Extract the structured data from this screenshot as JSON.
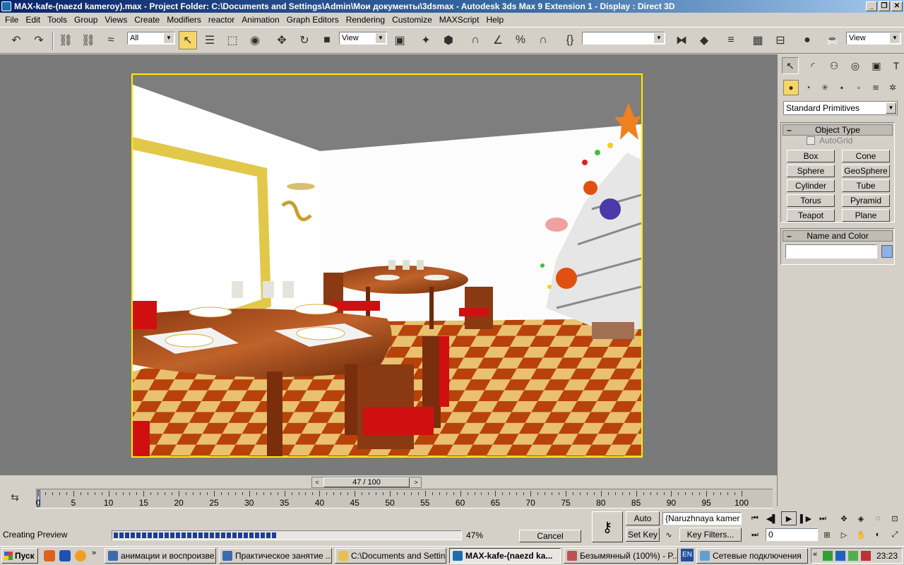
{
  "window": {
    "title": "MAX-kafe-(naezd kameroy).max     - Project Folder: C:\\Documents and Settings\\Admin\\Мои документы\\3dsmax     - Autodesk 3ds Max 9 Extension 1      - Display : Direct 3D"
  },
  "menu": [
    "File",
    "Edit",
    "Tools",
    "Group",
    "Views",
    "Create",
    "Modifiers",
    "reactor",
    "Animation",
    "Graph Editors",
    "Rendering",
    "Customize",
    "MAXScript",
    "Help"
  ],
  "toolbar": {
    "selection_filter": "All",
    "ref_coord": "View",
    "named_selection": "",
    "view_select": "View"
  },
  "command_panel": {
    "category": "Standard Primitives",
    "object_type": {
      "title": "Object Type",
      "autogrid": "AutoGrid",
      "buttons": [
        "Box",
        "Cone",
        "Sphere",
        "GeoSphere",
        "Cylinder",
        "Tube",
        "Torus",
        "Pyramid",
        "Teapot",
        "Plane"
      ]
    },
    "name_and_color": {
      "title": "Name and Color",
      "name": "",
      "color": "#8fb0e8"
    }
  },
  "timeline": {
    "frame_label": "47 / 100",
    "current_frame": 47,
    "total_frames": 100,
    "ticks": [
      "0",
      "5",
      "10",
      "15",
      "20",
      "25",
      "30",
      "35",
      "40",
      "45",
      "50",
      "55",
      "60",
      "65",
      "70",
      "75",
      "80",
      "85",
      "90",
      "95",
      "100"
    ]
  },
  "status": {
    "text": "Creating Preview",
    "progress_percent": 47,
    "progress_label": "47%",
    "cancel": "Cancel"
  },
  "anim_controls": {
    "auto_key": "Auto Key",
    "set_key": "Set Key",
    "key_filters": "Key Filters...",
    "selection_set": "{Naruzhnaya kamer",
    "frame_field": "0"
  },
  "taskbar": {
    "start": "Пуск",
    "tasks": [
      "анимации и воспроизве...",
      "Практическое занятие ...",
      "C:\\Documents and Settin...",
      "MAX-kafe-(naezd ka...",
      "Безымянный (100%) - P...",
      "Сетевые подключения"
    ],
    "lang": "EN",
    "clock": "23:23"
  },
  "colors": {
    "accent": "#ffea00",
    "title_bar": "#0a246a",
    "viewport_bg": "#7a7a7a",
    "progress": "#1b3d9c"
  }
}
